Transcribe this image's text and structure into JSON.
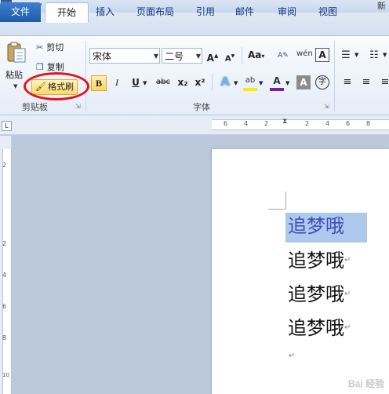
{
  "title": {
    "text": "新"
  },
  "tabs": {
    "file": "文件",
    "home": "开始",
    "insert": "插入",
    "page_layout": "页面布局",
    "references": "引用",
    "mailings": "邮件",
    "review": "审阅",
    "view": "视图"
  },
  "clipboard": {
    "paste": "粘贴",
    "cut": "剪切",
    "copy": "复制",
    "format_painter": "格式刷",
    "group_label": "剪贴板"
  },
  "font": {
    "name": "宋体",
    "size": "二号",
    "group_label": "字体",
    "case_btn": "Aa",
    "bold": "B",
    "italic": "I",
    "underline": "U",
    "strike": "abc",
    "sub": "x₂",
    "sup": "x²"
  },
  "ruler": {
    "h_numbers": [
      "6",
      "4",
      "2",
      "2",
      "4",
      "6",
      "8"
    ],
    "v_numbers": [
      "2",
      "2",
      "4",
      "6",
      "8",
      "10"
    ]
  },
  "document": {
    "lines": [
      "追梦哦",
      "追梦哦",
      "追梦哦",
      "追梦哦"
    ],
    "paragraph_mark": "↵"
  },
  "watermark": "Bai 经验"
}
